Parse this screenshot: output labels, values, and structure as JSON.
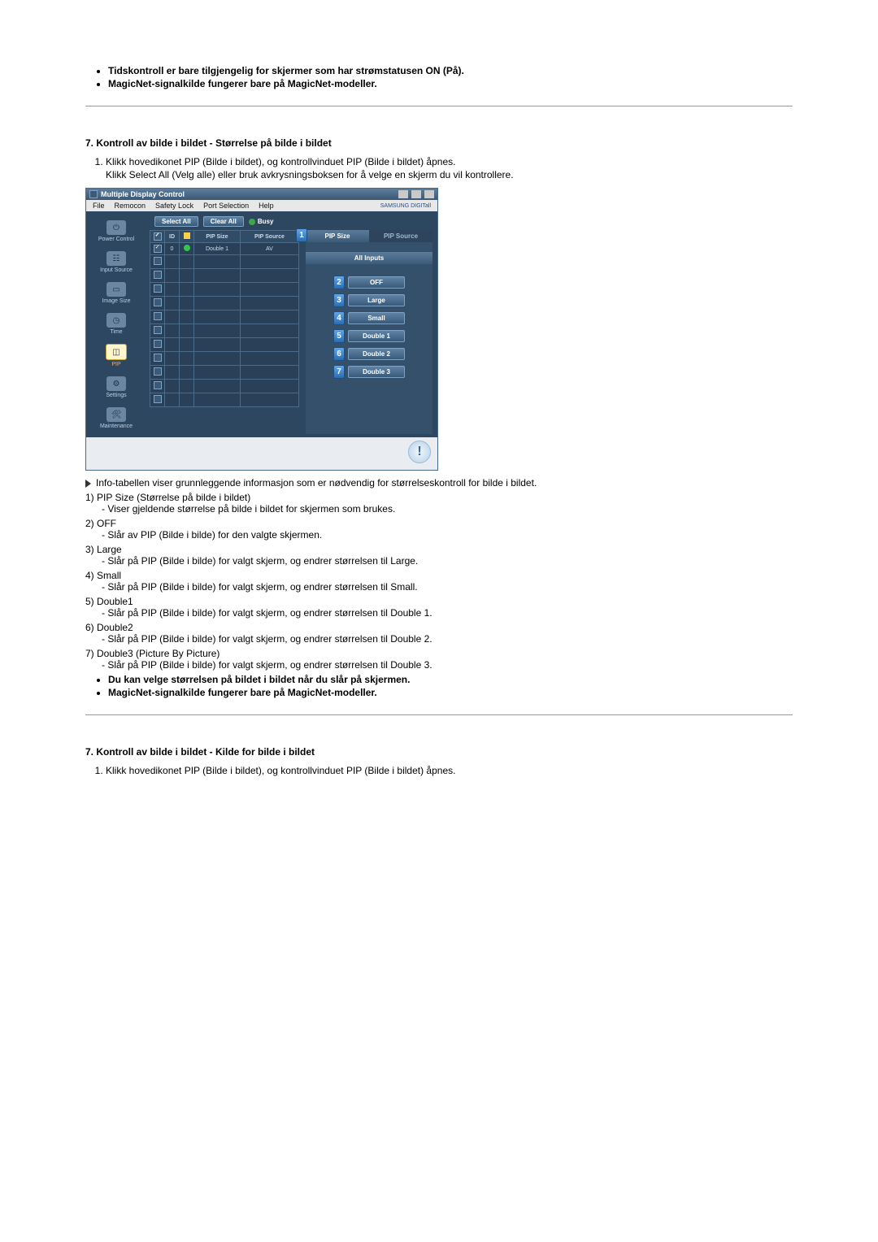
{
  "top_bullets": [
    "Tidskontroll er bare tilgjengelig for skjermer som har strømstatusen ON (På).",
    "MagicNet-signalkilde fungerer bare på MagicNet-modeller."
  ],
  "section1": {
    "heading": "7. Kontroll av bilde i bildet - Størrelse på bilde i bildet",
    "step1": "Klikk hovedikonet PIP (Bilde i bildet), og kontrollvinduet PIP (Bilde i bildet) åpnes.",
    "step1b": "Klikk Select All (Velg alle) eller bruk avkrysningsboksen for å velge en skjerm du vil kontrollere."
  },
  "app": {
    "title": "Multiple Display Control",
    "menus": [
      "File",
      "Remocon",
      "Safety Lock",
      "Port Selection",
      "Help"
    ],
    "brand": "SAMSUNG DIGITall",
    "sidebar": [
      {
        "label": "Power Control"
      },
      {
        "label": "Input Source"
      },
      {
        "label": "Image Size"
      },
      {
        "label": "Time"
      },
      {
        "label": "PIP"
      },
      {
        "label": "Settings"
      },
      {
        "label": "Maintenance"
      }
    ],
    "toolbar": {
      "select_all": "Select All",
      "clear_all": "Clear All",
      "busy": "Busy"
    },
    "table": {
      "headers": {
        "id": "ID",
        "pip_size": "PIP Size",
        "pip_source": "PIP Source"
      },
      "row0": {
        "id": "0",
        "pip_size": "Double 1",
        "pip_source": "AV"
      }
    },
    "right": {
      "tab_active": "PIP Size",
      "tab_inactive": "PIP Source",
      "panel_title": "All Inputs",
      "buttons": [
        "OFF",
        "Large",
        "Small",
        "Double 1",
        "Double 2",
        "Double 3"
      ],
      "callouts": [
        "1",
        "2",
        "3",
        "4",
        "5",
        "6",
        "7"
      ]
    }
  },
  "after": {
    "info_line": "Info-tabellen viser grunnleggende informasjon som er nødvendig for størrelseskontroll for bilde i bildet.",
    "items": [
      {
        "n": "1)",
        "t": "PIP Size (Størrelse på bilde i bildet)",
        "d": "- Viser gjeldende størrelse på bilde i bildet for skjermen som brukes."
      },
      {
        "n": "2)",
        "t": "OFF",
        "d": "- Slår av PIP (Bilde i bilde) for den valgte skjermen."
      },
      {
        "n": "3)",
        "t": "Large",
        "d": "- Slår på PIP (Bilde i bilde) for valgt skjerm, og endrer størrelsen til Large."
      },
      {
        "n": "4)",
        "t": "Small",
        "d": "- Slår på PIP (Bilde i bilde) for valgt skjerm, og endrer størrelsen til Small."
      },
      {
        "n": "5)",
        "t": "Double1",
        "d": "- Slår på PIP (Bilde i bilde) for valgt skjerm, og endrer størrelsen til Double 1."
      },
      {
        "n": "6)",
        "t": "Double2",
        "d": "- Slår på PIP (Bilde i bilde) for valgt skjerm, og endrer størrelsen til Double 2."
      },
      {
        "n": "7)",
        "t": "Double3 (Picture By Picture)",
        "d": "- Slår på PIP (Bilde i bilde) for valgt skjerm, og endrer størrelsen til Double 3."
      }
    ],
    "bullets": [
      "Du kan velge størrelsen på bildet i bildet når du slår på skjermen.",
      "MagicNet-signalkilde fungerer bare på MagicNet-modeller."
    ]
  },
  "section2": {
    "heading": "7. Kontroll av bilde i bildet - Kilde for bilde i bildet",
    "step1": "Klikk hovedikonet PIP (Bilde i bildet), og kontrollvinduet PIP (Bilde i bildet) åpnes."
  }
}
